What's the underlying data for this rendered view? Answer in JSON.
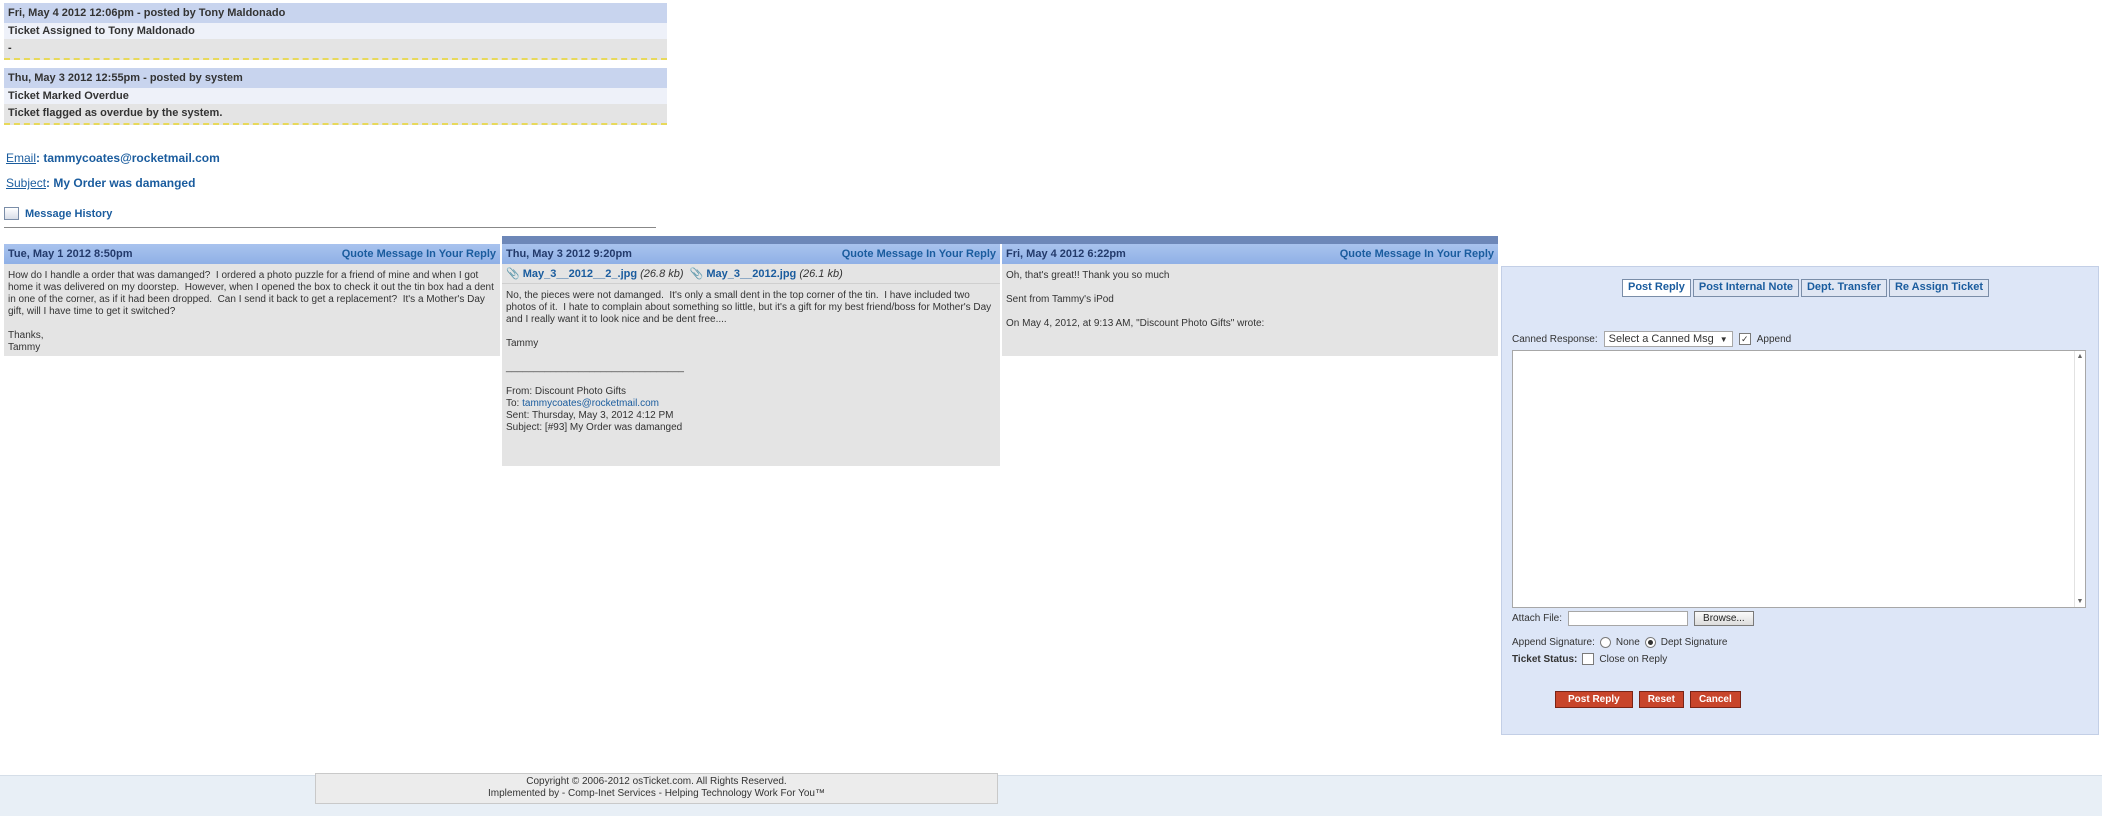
{
  "notes": [
    {
      "header": "Fri, May 4 2012 12:06pm -  posted by Tony Maldonado",
      "title": "Ticket Assigned to Tony Maldonado",
      "body": "-"
    },
    {
      "header": "Thu, May 3 2012 12:55pm -  posted by system",
      "title": "Ticket Marked Overdue",
      "body": "Ticket flagged as overdue by the system."
    }
  ],
  "ticket": {
    "email_label": "Email",
    "email": "tammycoates@rocketmail.com",
    "subject_label": "Subject",
    "subject": "My Order was damanged"
  },
  "history": {
    "label": "Message History"
  },
  "messages": [
    {
      "date": "Tue, May 1 2012 8:50pm",
      "quote": "Quote Message In Your Reply",
      "body": "How do I handle a order that was damanged?  I ordered a photo puzzle for a friend of mine and when I got home it was delivered on my doorstep.  However, when I opened the box to check it out the tin box had a dent in one of the corner, as if it had been dropped.  Can I send it back to get a replacement?  It's a Mother's Day gift, will I have time to get it switched?\n\nThanks,\nTammy"
    },
    {
      "date": "Thu, May 3 2012 9:20pm",
      "quote": "Quote Message In Your Reply",
      "attachments": [
        {
          "name": "May_3__2012__2_.jpg",
          "size": "(26.8 kb)"
        },
        {
          "name": "May_3__2012.jpg",
          "size": "(26.1 kb)"
        }
      ],
      "body": "No, the pieces were not damanged.  It's only a small dent in the top corner of the tin.  I have included two photos of it.  I hate to complain about something so little, but it's a gift for my best friend/boss for Mother's Day and I really want it to look nice and be dent free....\n\nTammy",
      "divider": "________________________________",
      "from": "From: Discount Photo Gifts",
      "to_label": "To: ",
      "to": "tammycoates@rocketmail.com",
      "sent": "Sent: Thursday, May 3, 2012 4:12 PM",
      "subject": "Subject: [#93] My Order was damanged"
    },
    {
      "date": "Fri, May 4 2012 6:22pm",
      "quote": "Quote Message In Your Reply",
      "body": "Oh, that's great!! Thank you so much\n\nSent from Tammy's iPod\n\nOn May 4, 2012, at 9:13 AM, \"Discount Photo Gifts\" wrote:"
    }
  ],
  "reply": {
    "tabs": [
      "Post Reply",
      "Post Internal Note",
      "Dept. Transfer",
      "Re Assign Ticket"
    ],
    "canned_label": "Canned Response:",
    "canned_select": "Select a Canned Msg",
    "append_label": "Append",
    "append_checked": true,
    "attach_label": "Attach File:",
    "browse_label": "Browse...",
    "signature_label": "Append Signature:",
    "sig_none": "None",
    "sig_dept": "Dept Signature",
    "status_label": "Ticket Status:",
    "close_label": "Close on Reply",
    "buttons": {
      "post": "Post Reply",
      "reset": "Reset",
      "cancel": "Cancel"
    }
  },
  "footer": {
    "line1": "Copyright © 2006-2012 osTicket.com.  All Rights Reserved.",
    "line2": "Implemented by - Comp-Inet Services - Helping Technology Work For You™"
  },
  "colors": {
    "header_blue": "#a9c3ee",
    "link": "#1a5c9e",
    "button_red": "#c8452b",
    "panel": "#dde6f7"
  }
}
